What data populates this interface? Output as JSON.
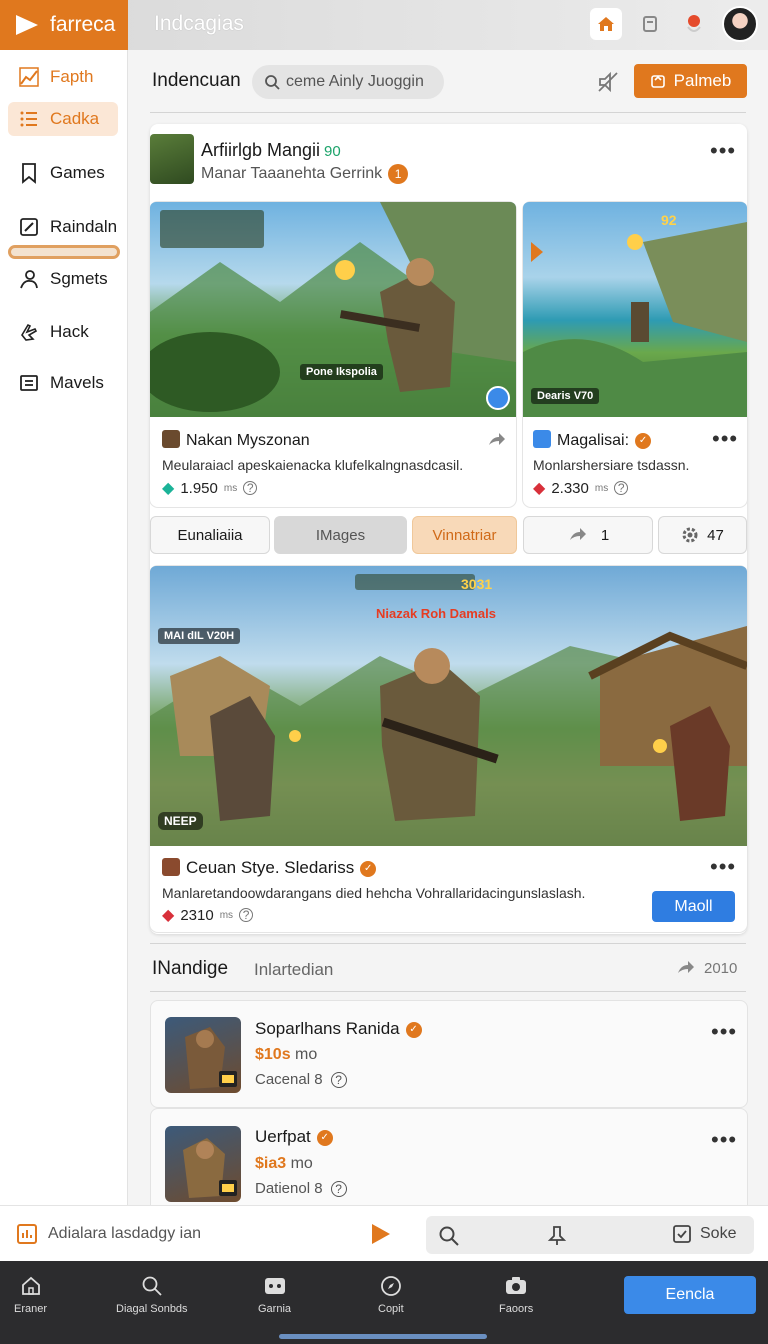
{
  "app": {
    "brand": "farreca",
    "top_title": "Indcagias"
  },
  "sidebar": {
    "items": [
      {
        "label": "Fapth",
        "icon": "chart-icon"
      },
      {
        "label": "Cadka",
        "icon": "list-icon"
      },
      {
        "label": "Games",
        "icon": "bookmark-icon"
      },
      {
        "label": "Raindaln",
        "icon": "edit-icon"
      },
      {
        "label": "Sgmets",
        "icon": "user-icon"
      },
      {
        "label": "Hack",
        "icon": "hand-icon"
      },
      {
        "label": "Mavels",
        "icon": "text-icon"
      }
    ]
  },
  "header": {
    "title": "Indencuan",
    "search_placeholder": "ceme Ainly Juoggin",
    "primary_button": "Palmeb"
  },
  "post": {
    "title": "Arfiirlgb Mangii",
    "badge": "90",
    "subtitle": "Manar Taaanehta Gerrink",
    "sub_badge": "1"
  },
  "game_cards": [
    {
      "name": "Nakan Myszonan",
      "desc": "Meularaiacl apeskaienacka klufelkalngnasdcasil.",
      "stat": "1.950",
      "stat_unit": "ms",
      "hud_label": "Pone Ikspolia"
    },
    {
      "name": "Magalisai:",
      "desc": "Monlarshersiare tsdassn.",
      "stat": "2.330",
      "stat_unit": "ms",
      "hud_label": "Dearis V70",
      "hud_score": "92"
    }
  ],
  "tabs": [
    {
      "label": "Eunaliaiia"
    },
    {
      "label": "IMages"
    },
    {
      "label": "Vinnatriar"
    },
    {
      "label": "1"
    },
    {
      "label": "47"
    }
  ],
  "featured": {
    "hud_title": "Niazak Roh Damals",
    "hud_score": "3031",
    "hud_left": "MAI dIL V20H",
    "hud_badge": "NEEP",
    "title": "Ceuan Stye. Sledariss",
    "desc": "Manlaretandoowdarangans died hehcha Vohrallaridacingunslaslash.",
    "stat": "2310",
    "stat_unit": "ms",
    "button": "Maoll"
  },
  "section": {
    "title": "INandige",
    "subtitle": "Inlartedian",
    "share_count": "2010"
  },
  "list": [
    {
      "title": "Soparlhans Ranida",
      "price": "$10s",
      "price_unit": "mo",
      "meta": "Cacenal 8"
    },
    {
      "title": "Uerfpat",
      "price": "$ia3",
      "price_unit": "mo",
      "meta": "Datienol 8"
    }
  ],
  "footer_strip": {
    "text": "Adialara lasdadgy ian",
    "right_label": "Soke"
  },
  "bottom_nav": {
    "items": [
      {
        "label": "Eraner",
        "icon": "home-icon"
      },
      {
        "label": "Diagal Sonbds",
        "icon": "search-icon"
      },
      {
        "label": "Garnia",
        "icon": "gamepad-icon"
      },
      {
        "label": "Copit",
        "icon": "compass-icon"
      },
      {
        "label": "Faoors",
        "icon": "camera-icon"
      }
    ],
    "button": "Eencla"
  },
  "colors": {
    "accent": "#e0781e",
    "blue": "#3b8ae8",
    "nav_bg": "#2c2c2e"
  }
}
